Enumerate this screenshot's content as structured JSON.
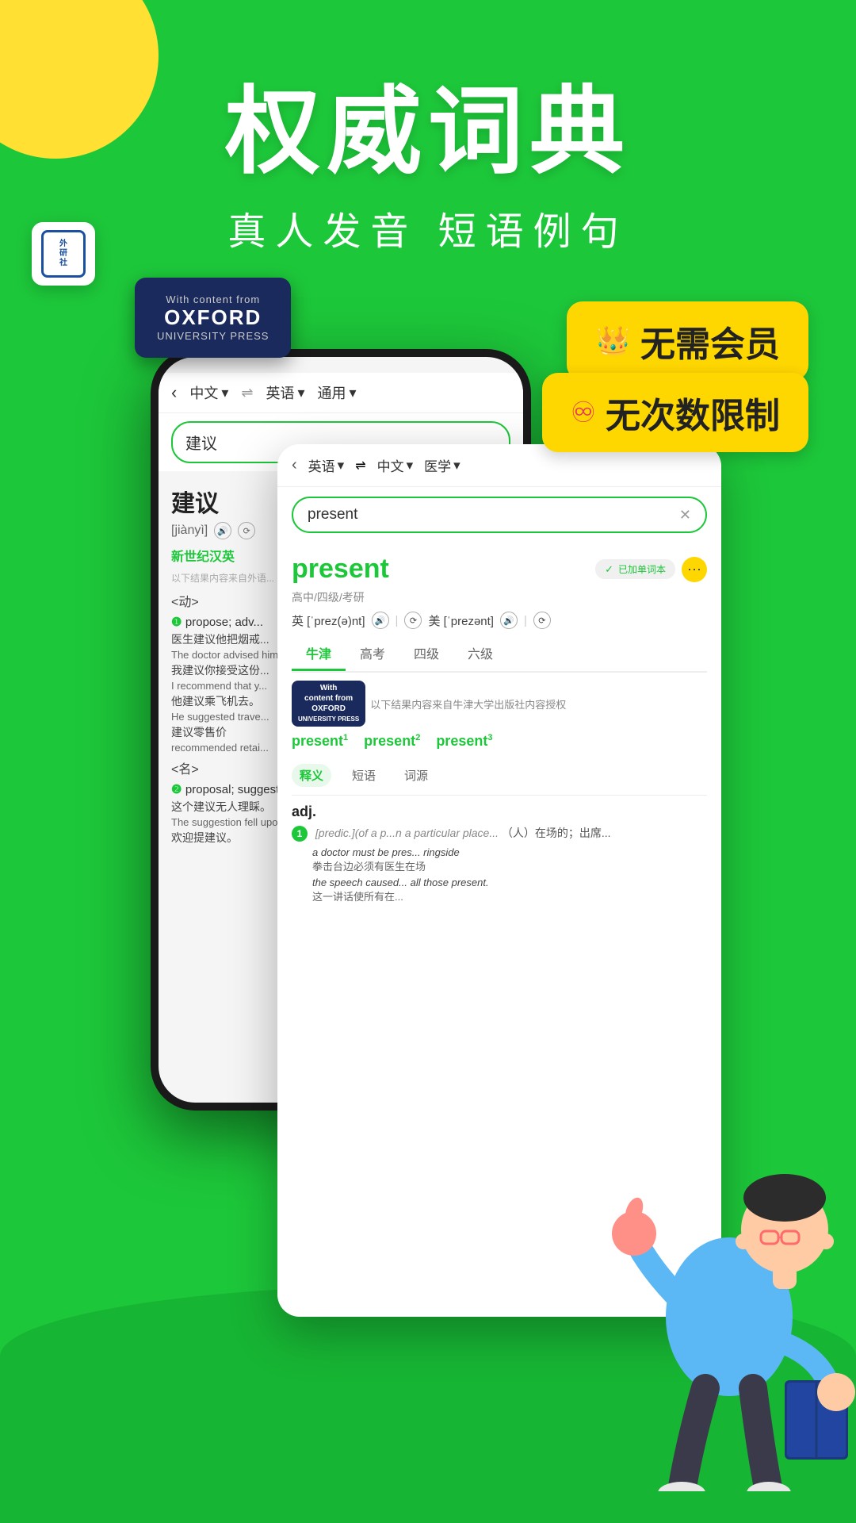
{
  "app": {
    "background_color": "#1DC73A"
  },
  "header": {
    "main_title": "权威词典",
    "sub_title": "真人发音  短语例句"
  },
  "badges": {
    "no_member": {
      "icon": "👑",
      "text": "无需会员"
    },
    "unlimited": {
      "icon": "♾",
      "text": "无次数限制"
    }
  },
  "phone_left": {
    "nav": {
      "back": "‹",
      "lang1": "中文",
      "arrow": "⇌",
      "lang2": "英语",
      "mode": "通用"
    },
    "search_query": "建议",
    "word": "建议",
    "pinyin": "[jiànyì]",
    "dict_source": "新世纪汉英",
    "notice": "以下结果内容来自外语...",
    "pos1": "<动>",
    "entries": [
      {
        "num": "❶",
        "def": "propose; adv...",
        "examples": [
          {
            "zh": "医生建议他把烟戒...",
            "en": "The doctor advised him to stop smoking."
          },
          {
            "zh": "我建议你接受这份...",
            "en": "I recommend that y..."
          },
          {
            "zh": "他建议乘飞机去。",
            "en": "He suggested trave..."
          },
          {
            "zh": "建议零售价",
            "en": "recommended retai..."
          }
        ]
      }
    ],
    "pos2": "<名>",
    "entries2": [
      {
        "num": "❷",
        "def": "proposal; suggesti...",
        "examples": [
          {
            "zh": "这个建议无人理睬。",
            "en": "The suggestion fell upon deaf ears."
          },
          {
            "zh": "欢迎提建议。",
            "en": ""
          }
        ]
      }
    ]
  },
  "dict_card": {
    "nav": {
      "back": "‹",
      "lang1": "英语",
      "arrow": "⇌",
      "lang2": "中文",
      "mode": "医学"
    },
    "search_query": "present",
    "word": "present",
    "bookmarked": "✓ 已加单词本",
    "level": "高中/四级/考研",
    "phonetic_uk": "英 [ˈprez(ə)nt]",
    "phonetic_us": "美 [ˈprezənt]",
    "tabs": [
      "牛津",
      "高考",
      "四级",
      "六级"
    ],
    "active_tab": "牛津",
    "oxford_notice": "以下结果内容来自牛津大学出版社内容授权",
    "oxford_small_logo": "OXFORD\nUNIVERSITY\nPRESS",
    "present_variants": [
      {
        "text": "present",
        "sup": "1"
      },
      {
        "text": "present",
        "sup": "2"
      },
      {
        "text": "present",
        "sup": "3"
      }
    ],
    "sub_tabs": [
      "释义",
      "短语",
      "词源"
    ],
    "active_sub_tab": "释义",
    "pos": "adj.",
    "definitions": [
      {
        "num": "1",
        "note": "[predic.](of a p...n a particular place...",
        "zh": "（人）在场的；出席...",
        "examples": [
          {
            "en": "a doctor must be pres... ringside",
            "zh": "拳击台边必须有医生在场"
          },
          {
            "en": "the speech caused... all those present.",
            "zh": "这一讲话使所有在..."
          }
        ]
      }
    ]
  },
  "oxford_badge": {
    "line1": "With content from",
    "line2": "OXFORD",
    "line3": "UNIVERSITY PRESS"
  },
  "waiyanshe": {
    "label": "外研社"
  }
}
